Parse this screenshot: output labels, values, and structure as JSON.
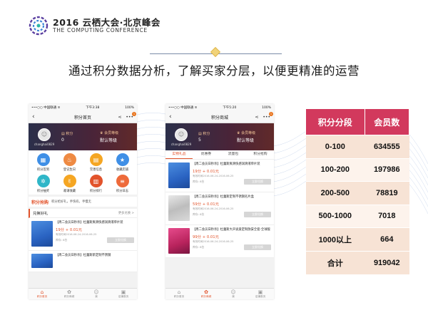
{
  "header": {
    "logo_line1": "2016 云栖大会·北京峰会",
    "logo_line2": "THE COMPUTING CONFERENCE"
  },
  "heading": "通过积分数据分析，了解买家分层，以便更精准的运营",
  "phone_common": {
    "carrier": "•••○○ 中国联通 ≋",
    "battery": "100%",
    "username": "changhai0829",
    "points_label": "积分",
    "level_label": "会员等级",
    "level_value": "默认等级"
  },
  "phone1": {
    "time": "下午3:38",
    "title": "积分首页",
    "points_value": "0",
    "grid": [
      {
        "label": "积分签到",
        "icon": "calendar-icon",
        "color": "#3f8fe6"
      },
      {
        "label": "登记生日",
        "icon": "cake-icon",
        "color": "#ee8a43"
      },
      {
        "label": "完善信息",
        "icon": "form-icon",
        "color": "#f5a623"
      },
      {
        "label": "收藏店铺",
        "icon": "star-icon",
        "color": "#3f8fe6"
      },
      {
        "label": "积分抽奖",
        "icon": "wheel-icon",
        "color": "#2fb6c8"
      },
      {
        "label": "邀请收藏",
        "icon": "thumb-icon",
        "color": "#f5a623"
      },
      {
        "label": "积分排行",
        "icon": "chart-icon",
        "color": "#e2532b"
      },
      {
        "label": "积分日志",
        "icon": "log-icon",
        "color": "#ee6a3a"
      }
    ],
    "lottery_title": "积分抢购",
    "lottery_text": "积分抢好礼，手快有，手慢无",
    "section_title": "兑换好礼",
    "section_more": "更多兑换 >",
    "products": [
      {
        "name": "【周二会员日秒杀】杜蕾斯爽滑快感润滑液单片装",
        "price": "19分 + 0.01元",
        "time": "有效时间2016-06-24-2016-06-25",
        "stock": "库存: 8台",
        "button": "立即兑换"
      },
      {
        "name": "【周二会员日秒杀】杜蕾斯新定制不锈钢",
        "price": "",
        "time": "",
        "stock": "",
        "button": ""
      }
    ],
    "tabbar": [
      {
        "label": "积分首页",
        "icon": "home-icon",
        "active": true
      },
      {
        "label": "积分商城",
        "icon": "gift-icon",
        "active": false
      },
      {
        "label": "我",
        "icon": "user-icon",
        "active": false
      },
      {
        "label": "店铺首页",
        "icon": "shop-icon",
        "active": false
      }
    ]
  },
  "phone2": {
    "time": "下午5:20",
    "title": "积分商城",
    "points_value": "5",
    "tabs": [
      "实物礼品",
      "优惠券",
      "流量包",
      "积分抢购"
    ],
    "products": [
      {
        "name": "【周二会员日秒杀】杜蕾斯爽滑快感润滑液单片装",
        "price": "19分 + 0.01元",
        "time": "有效时间2016-06-24-2016-06-25",
        "stock": "库存: 8台",
        "button": "立即兑换",
        "img": "img-blue"
      },
      {
        "name": "【周二会员日秒杀】杜蕾斯定制不锈钢名片盒",
        "price": "59分 + 0.01元",
        "time": "有效时间2016-06-24-2016-06-25",
        "stock": "库存: 8台",
        "button": "立即兑换",
        "img": "img-steel"
      },
      {
        "name": "【周二会员日秒杀】杜蕾斯大声说爱定制款安全套·全球版",
        "price": "99分 + 0.01元",
        "time": "有效时间2016-06-24-2016-06-25",
        "stock": "库存: 8台",
        "button": "立即兑换",
        "img": "img-pink"
      }
    ],
    "tabbar": [
      {
        "label": "积分首页",
        "icon": "home-icon",
        "active": false
      },
      {
        "label": "积分商城",
        "icon": "gift-icon",
        "active": true
      },
      {
        "label": "我",
        "icon": "user-icon",
        "active": false
      },
      {
        "label": "店铺首页",
        "icon": "shop-icon",
        "active": false
      }
    ]
  },
  "table": {
    "headers": [
      "积分分段",
      "会员数"
    ],
    "rows": [
      [
        "0-100",
        "634555"
      ],
      [
        "100-200",
        "197986"
      ],
      [
        "200-500",
        "78819"
      ],
      [
        "500-1000",
        "7018"
      ],
      [
        "1000以上",
        "664"
      ],
      [
        "合计",
        "919042"
      ]
    ]
  },
  "colors": {
    "accent": "#e2532b",
    "table_header": "#d2395d",
    "table_row_dark": "#f7e3d5",
    "table_row_light": "#fdf3ec"
  }
}
